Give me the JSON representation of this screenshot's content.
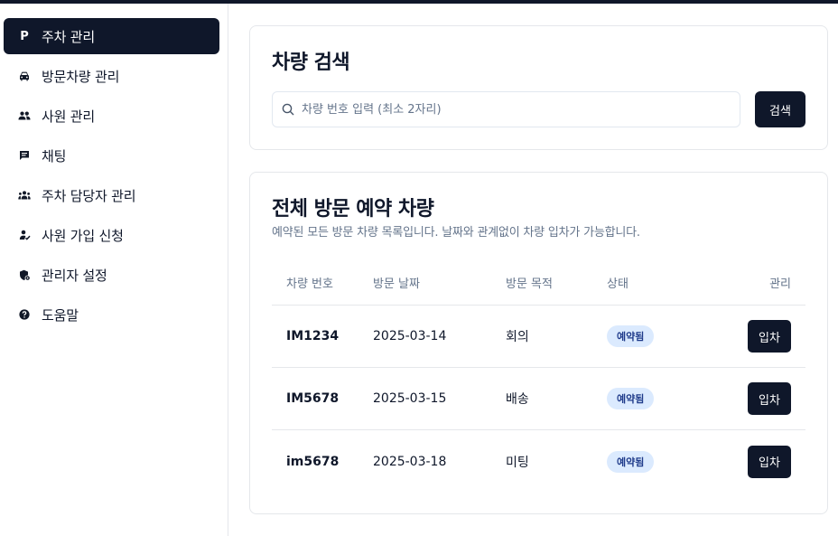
{
  "sidebar": {
    "items": [
      {
        "label": "주차 관리",
        "icon": "parking-icon",
        "active": true
      },
      {
        "label": "방문차량 관리",
        "icon": "car-icon"
      },
      {
        "label": "사원 관리",
        "icon": "people-icon"
      },
      {
        "label": "채팅",
        "icon": "chat-icon"
      },
      {
        "label": "주차 담당자 관리",
        "icon": "group-icon"
      },
      {
        "label": "사원 가입 신청",
        "icon": "person-add-icon"
      },
      {
        "label": "관리자 설정",
        "icon": "admin-settings-icon"
      },
      {
        "label": "도움말",
        "icon": "help-icon"
      }
    ],
    "parking_glyph": "P"
  },
  "search": {
    "title": "차량 검색",
    "placeholder": "차량 번호 입력 (최소 2자리)",
    "button_label": "검색"
  },
  "reservations": {
    "title": "전체 방문 예약 차량",
    "description": "예약된 모든 방문 차량 목록입니다. 날짜와 관계없이 차량 입차가 가능합니다.",
    "columns": [
      "차량 번호",
      "방문 날짜",
      "방문 목적",
      "상태",
      "관리"
    ],
    "rows": [
      {
        "plate": "IM1234",
        "date": "2025-03-14",
        "purpose": "회의",
        "status": "예약됨",
        "action": "입차"
      },
      {
        "plate": "IM5678",
        "date": "2025-03-15",
        "purpose": "배송",
        "status": "예약됨",
        "action": "입차"
      },
      {
        "plate": "im5678",
        "date": "2025-03-18",
        "purpose": "미팅",
        "status": "예약됨",
        "action": "입차"
      }
    ]
  },
  "colors": {
    "primary": "#0f172a",
    "badge_bg": "#dbeafe",
    "badge_text": "#1e3a8a",
    "muted": "#64748b",
    "border": "#e5e7eb"
  }
}
